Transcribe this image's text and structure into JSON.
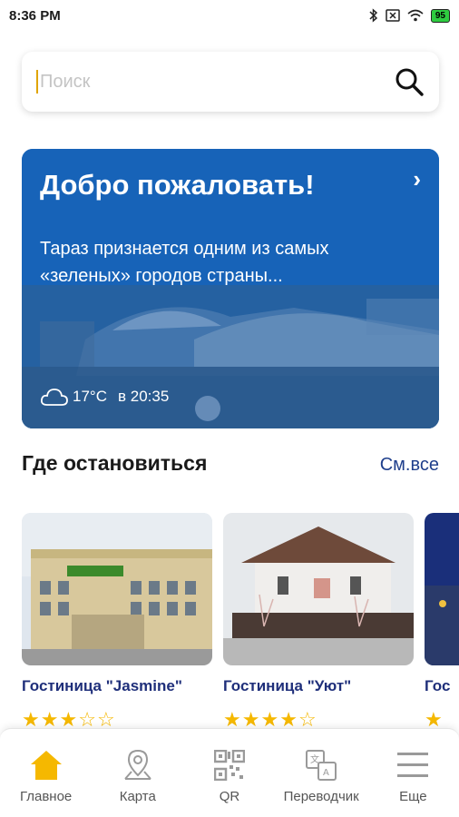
{
  "status_bar": {
    "time": "8:36 PM",
    "battery": "95",
    "icons": [
      "bluetooth-icon",
      "sim-icon",
      "wifi-icon",
      "battery-icon"
    ]
  },
  "search": {
    "placeholder": "Поиск",
    "value": ""
  },
  "hero": {
    "title": "Добро пожаловать!",
    "description": "Тараз признается одним из самых «зеленых» городов страны...",
    "temperature": "17°C",
    "time": "в 20:35",
    "icon": "cloud-icon",
    "colors": {
      "overlay": "#1563b5"
    }
  },
  "stays": {
    "title": "Где остановиться",
    "see_all": "См.все",
    "items": [
      {
        "name": "Гостиница \"Jasmine\"",
        "rating": 3,
        "max": 5
      },
      {
        "name": "Гостиница \"Уют\"",
        "rating": 4,
        "max": 5
      },
      {
        "name": "Гос",
        "rating": 1,
        "max": 5
      }
    ]
  },
  "bottom_nav": {
    "items": [
      {
        "label": "Главное",
        "icon": "home-icon",
        "active": true
      },
      {
        "label": "Карта",
        "icon": "map-pin-icon",
        "active": false
      },
      {
        "label": "QR",
        "icon": "qr-code-icon",
        "active": false
      },
      {
        "label": "Переводчик",
        "icon": "translate-icon",
        "active": false
      },
      {
        "label": "Еще",
        "icon": "menu-icon",
        "active": false
      }
    ],
    "colors": {
      "active": "#f5b800",
      "inactive": "#9a9a9a"
    }
  }
}
